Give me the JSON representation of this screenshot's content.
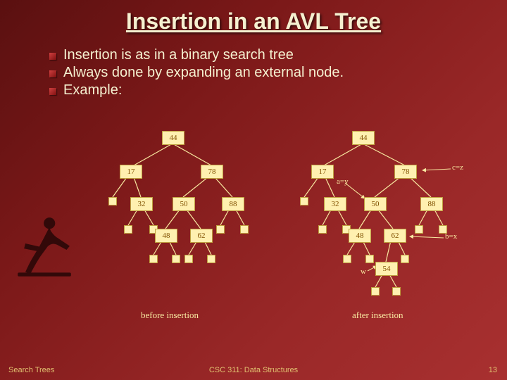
{
  "title": "Insertion in an AVL Tree",
  "bullets": [
    "Insertion is as in a binary search tree",
    "Always done by expanding an external node.",
    "Example:"
  ],
  "left_tree": {
    "n44": "44",
    "n17": "17",
    "n78": "78",
    "n32": "32",
    "n50": "50",
    "n88": "88",
    "n48": "48",
    "n62": "62"
  },
  "right_tree": {
    "n44": "44",
    "n17": "17",
    "n78": "78",
    "n32": "32",
    "n50": "50",
    "n88": "88",
    "n48": "48",
    "n62": "62",
    "n54": "54"
  },
  "labels": {
    "cz": "c=z",
    "ay": "a=y",
    "bx": "b=x",
    "w": "w"
  },
  "captions": {
    "before": "before insertion",
    "after": "after insertion"
  },
  "footer": {
    "left": "Search Trees",
    "center": "CSC 311: Data Structures",
    "right": "13"
  }
}
